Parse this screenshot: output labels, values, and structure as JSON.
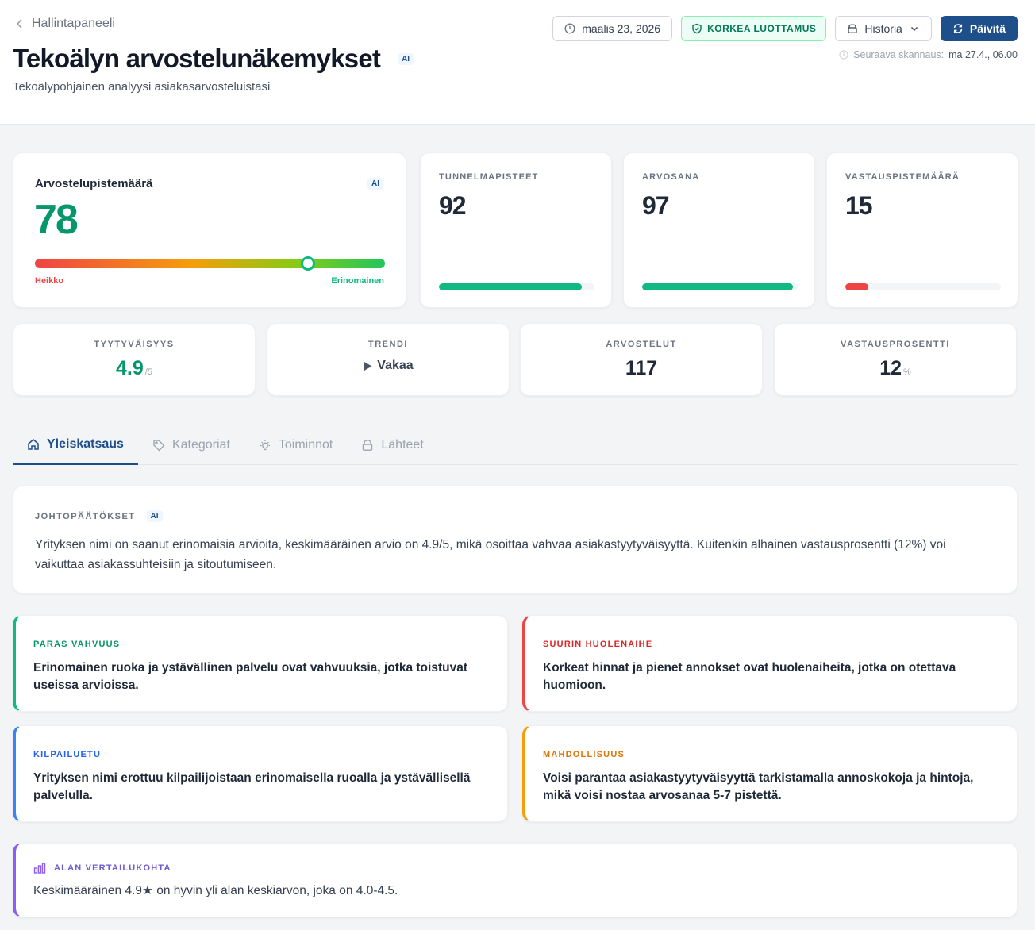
{
  "header": {
    "back_label": "Hallintapaneeli",
    "title": "Tekoälyn arvostelunäkemykset",
    "ai_badge": "AI",
    "subtitle": "Tekoälypohjainen analyysi asiakasarvosteluistasi",
    "date": "maalis 23, 2026",
    "confidence": "KORKEA LUOTTAMUS",
    "history_label": "Historia",
    "refresh_label": "Päivitä",
    "next_scan_label": "Seuraava skannaus:",
    "next_scan_value": "ma 27.4., 06.00"
  },
  "score": {
    "label": "Arvostelupistemäärä",
    "ai_badge": "AI",
    "value": "78",
    "gauge_fraction": 0.78,
    "low_label": "Heikko",
    "high_label": "Erinomainen"
  },
  "metrics": [
    {
      "label": "TUNNELMAPISTEET",
      "value": "92",
      "fraction": 0.92,
      "color": "#10b981"
    },
    {
      "label": "ARVOSANA",
      "value": "97",
      "fraction": 0.97,
      "color": "#10b981"
    },
    {
      "label": "VASTAUSPISTEMÄÄRÄ",
      "value": "15",
      "fraction": 0.15,
      "color": "#ef4444"
    }
  ],
  "stats": {
    "satisfaction": {
      "label": "TYYTYVÄISYYS",
      "value": "4.9",
      "unit": "/5",
      "color": "#059669"
    },
    "trend": {
      "label": "TRENDI",
      "value": "Vakaa"
    },
    "reviews": {
      "label": "ARVOSTELUT",
      "value": "117"
    },
    "response_rate": {
      "label": "VASTAUSPROSENTTI",
      "value": "12",
      "unit": "%"
    }
  },
  "tabs": [
    {
      "label": "Yleiskatsaus",
      "icon": "home-icon",
      "active": true
    },
    {
      "label": "Kategoriat",
      "icon": "tag-icon",
      "active": false
    },
    {
      "label": "Toiminnot",
      "icon": "lightbulb-icon",
      "active": false
    },
    {
      "label": "Lähteet",
      "icon": "lock-icon",
      "active": false
    }
  ],
  "conclusions": {
    "label": "JOHTOPÄÄTÖKSET",
    "ai_badge": "AI",
    "text": "Yrityksen nimi on saanut erinomaisia arvioita, keskimääräinen arvio on 4.9/5, mikä osoittaa vahvaa asiakastyytyväisyyttä. Kuitenkin alhainen vastausprosentti (12%) voi vaikuttaa asiakassuhteisiin ja sitoutumiseen."
  },
  "insights": {
    "strength": {
      "label": "PARAS VAHVUUS",
      "text": "Erinomainen ruoka ja ystävällinen palvelu ovat vahvuuksia, jotka toistuvat useissa arvioissa.",
      "color": "#10b981",
      "label_color": "#059669"
    },
    "concern": {
      "label": "SUURIN HUOLENAIHE",
      "text": "Korkeat hinnat ja pienet annokset ovat huolenaiheita, jotka on otettava huomioon.",
      "color": "#ef4444",
      "label_color": "#dc2626"
    },
    "advantage": {
      "label": "KILPAILUETU",
      "text": "Yrityksen nimi erottuu kilpailijoistaan erinomaisella ruoalla ja ystävällisellä palvelulla.",
      "color": "#3b82f6",
      "label_color": "#2563eb"
    },
    "opportunity": {
      "label": "MAHDOLLISUUS",
      "text": "Voisi parantaa asiakastyytyväisyyttä tarkistamalla annoskokoja ja hintoja, mikä voisi nostaa arvosanaa 5-7 pistettä.",
      "color": "#f59e0b",
      "label_color": "#d97706"
    }
  },
  "benchmark": {
    "label": "ALAN VERTAILUKOHTA",
    "text": "Keskimääräinen 4.9★ on hyvin yli alan keskiarvon, joka on 4.0-4.5."
  }
}
